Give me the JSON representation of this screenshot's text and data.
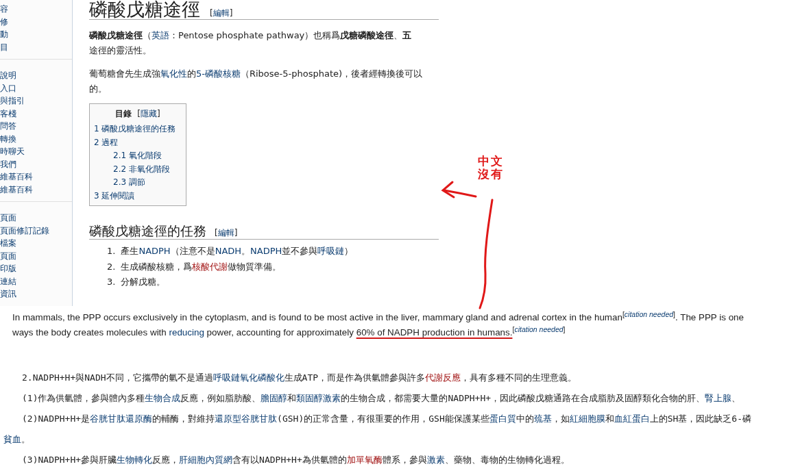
{
  "sidebar": {
    "groups": [
      [
        "容",
        "修",
        "動",
        "目"
      ],
      [
        "說明",
        "入口",
        "與指引",
        "客棧",
        "問答",
        "轉換",
        "時聊天",
        "我們",
        "維基百科",
        "維基百科"
      ],
      [
        "頁面",
        "頁面修訂記錄",
        "檔案",
        "頁面",
        "印版",
        "連結",
        "資訊"
      ]
    ]
  },
  "article": {
    "title": "磷酸戊糖途徑",
    "title_edit": [
      {
        "kind": "text",
        "text": "["
      },
      {
        "kind": "link",
        "text": "編輯"
      },
      {
        "kind": "text",
        "text": "]"
      }
    ],
    "paragraphs": [
      {
        "lines": [
          [
            {
              "kind": "bold",
              "text": "磷酸戊糖途徑"
            },
            {
              "kind": "text",
              "text": "（"
            },
            {
              "kind": "link",
              "text": "英語"
            },
            {
              "kind": "text",
              "text": "：Pentose phosphate pathway）也稱爲"
            },
            {
              "kind": "bold",
              "text": "戊糖磷酸途徑"
            },
            {
              "kind": "text",
              "text": "、"
            },
            {
              "kind": "bold",
              "text": "五"
            }
          ],
          [
            {
              "kind": "text",
              "text": "途徑的靈活性。"
            }
          ]
        ]
      },
      {
        "lines": [
          [
            {
              "kind": "text",
              "text": "葡萄糖會先生成強"
            },
            {
              "kind": "link",
              "text": "氧化性"
            },
            {
              "kind": "text",
              "text": "的"
            },
            {
              "kind": "link",
              "text": "5-磷酸核糖"
            },
            {
              "kind": "text",
              "text": "（Ribose-5-phosphate)，後者經轉換後可以"
            }
          ],
          [
            {
              "kind": "text",
              "text": "的。"
            }
          ]
        ]
      }
    ],
    "toc": {
      "title": "目錄",
      "toggle": [
        {
          "kind": "text",
          "text": "["
        },
        {
          "kind": "link",
          "text": "隱藏"
        },
        {
          "kind": "text",
          "text": "]"
        }
      ],
      "items": [
        {
          "number": "1",
          "label": "磷酸戊糖途徑的任務"
        },
        {
          "number": "2",
          "label": "過程",
          "children": [
            {
              "number": "2.1",
              "label": "氧化階段"
            },
            {
              "number": "2.2",
              "label": "非氧化階段"
            },
            {
              "number": "2.3",
              "label": "調節"
            }
          ]
        },
        {
          "number": "3",
          "label": "延伸閱讀"
        }
      ]
    },
    "section": {
      "title": "磷酸戊糖途徑的任務",
      "edit": [
        {
          "kind": "text",
          "text": "["
        },
        {
          "kind": "link",
          "text": "編輯"
        },
        {
          "kind": "text",
          "text": "]"
        }
      ],
      "list": [
        {
          "number": "1.",
          "segments": [
            {
              "kind": "text",
              "text": "產生"
            },
            {
              "kind": "link",
              "text": "NADPH"
            },
            {
              "kind": "text",
              "text": "（注意不是"
            },
            {
              "kind": "link",
              "text": "NADH"
            },
            {
              "kind": "text",
              "text": "。"
            },
            {
              "kind": "link",
              "text": "NADPH"
            },
            {
              "kind": "text",
              "text": "並不參與"
            },
            {
              "kind": "link",
              "text": "呼吸鏈"
            },
            {
              "kind": "text",
              "text": "）"
            }
          ]
        },
        {
          "number": "2.",
          "segments": [
            {
              "kind": "text",
              "text": "生成磷酸核糖，爲"
            },
            {
              "kind": "redlink",
              "text": "核酸代謝"
            },
            {
              "kind": "text",
              "text": "做物質準備。"
            }
          ]
        },
        {
          "number": "3.",
          "segments": [
            {
              "kind": "text",
              "text": "分解戊糖。"
            }
          ]
        }
      ]
    }
  },
  "english": {
    "lines": [
      [
        {
          "kind": "text",
          "text": "In mammals, the PPP occurs exclusively in the cytoplasm, and is found to be most active in the liver, mammary gland and adrenal cortex in the human"
        },
        {
          "kind": "sup",
          "text": "["
        },
        {
          "kind": "suplink",
          "text": "citation needed"
        },
        {
          "kind": "sup",
          "text": "]"
        },
        {
          "kind": "text",
          "text": ". The PPP is one"
        }
      ],
      [
        {
          "kind": "text",
          "text": "ways the body creates molecules with "
        },
        {
          "kind": "link",
          "text": "reducing"
        },
        {
          "kind": "text",
          "text": " power, accounting for approximately "
        },
        {
          "kind": "underlined",
          "text": "60% of NADPH production in humans."
        },
        {
          "kind": "sup",
          "text": "["
        },
        {
          "kind": "suplink",
          "text": "citation needed"
        },
        {
          "kind": "sup",
          "text": "]"
        }
      ]
    ]
  },
  "chinese": [
    {
      "indent": true,
      "segments": [
        {
          "kind": "text",
          "text": "2.NADPH+H+與NADH不同，它攜帶的氫不是通過"
        },
        {
          "kind": "link",
          "text": "呼吸鏈氧化磷酸化"
        },
        {
          "kind": "text",
          "text": "生成ATP，而是作為供氫體參與許多"
        },
        {
          "kind": "redlink",
          "text": "代謝反應"
        },
        {
          "kind": "text",
          "text": "，具有多種不同的生理意義。"
        }
      ]
    },
    {
      "indent": true,
      "segments": [
        {
          "kind": "text",
          "text": "(1)作為供氫體，參與體內多種"
        },
        {
          "kind": "link",
          "text": "生物合成"
        },
        {
          "kind": "text",
          "text": "反應，例如脂肪酸、"
        },
        {
          "kind": "link",
          "text": "膽固醇"
        },
        {
          "kind": "text",
          "text": "和"
        },
        {
          "kind": "link",
          "text": "類固醇激素"
        },
        {
          "kind": "text",
          "text": "的生物合成，都需要大量的NADPH+H+，因此磷酸戊糖通路在合成脂肪及固醇類化合物的肝、"
        },
        {
          "kind": "link",
          "text": "腎上腺"
        },
        {
          "kind": "text",
          "text": "、"
        }
      ]
    },
    {
      "indent": true,
      "segments": [
        {
          "kind": "text",
          "text": "(2)NADPH+H+是"
        },
        {
          "kind": "link",
          "text": "谷胱甘肽還原酶"
        },
        {
          "kind": "text",
          "text": "的輔酶，對維持"
        },
        {
          "kind": "link",
          "text": "還原型谷胱甘肽"
        },
        {
          "kind": "text",
          "text": "(GSH)的正常含量，有很重要的作用，GSH能保護某些"
        },
        {
          "kind": "link",
          "text": "蛋白質"
        },
        {
          "kind": "text",
          "text": "中的"
        },
        {
          "kind": "link",
          "text": "巯基"
        },
        {
          "kind": "text",
          "text": "，如"
        },
        {
          "kind": "link",
          "text": "紅細胞膜"
        },
        {
          "kind": "text",
          "text": "和"
        },
        {
          "kind": "link",
          "text": "血紅蛋白"
        },
        {
          "kind": "text",
          "text": "上的SH基，因此缺乏6-磷"
        }
      ]
    },
    {
      "indent": false,
      "segments": [
        {
          "kind": "link",
          "text": "貧血"
        },
        {
          "kind": "text",
          "text": "。"
        }
      ]
    },
    {
      "indent": true,
      "segments": [
        {
          "kind": "text",
          "text": "(3)NADPH+H+參與肝臟"
        },
        {
          "kind": "link",
          "text": "生物轉化"
        },
        {
          "kind": "text",
          "text": "反應，"
        },
        {
          "kind": "link",
          "text": "肝細胞內質網"
        },
        {
          "kind": "text",
          "text": "含有以NADPH+H+為供氫體的"
        },
        {
          "kind": "redlink",
          "text": "加單氧酶"
        },
        {
          "kind": "text",
          "text": "體系，參與"
        },
        {
          "kind": "link",
          "text": "激素"
        },
        {
          "kind": "text",
          "text": "、藥物、毒物的生物轉化過程。"
        }
      ]
    }
  ],
  "annotation": {
    "lines": [
      "中文",
      "沒有"
    ]
  }
}
